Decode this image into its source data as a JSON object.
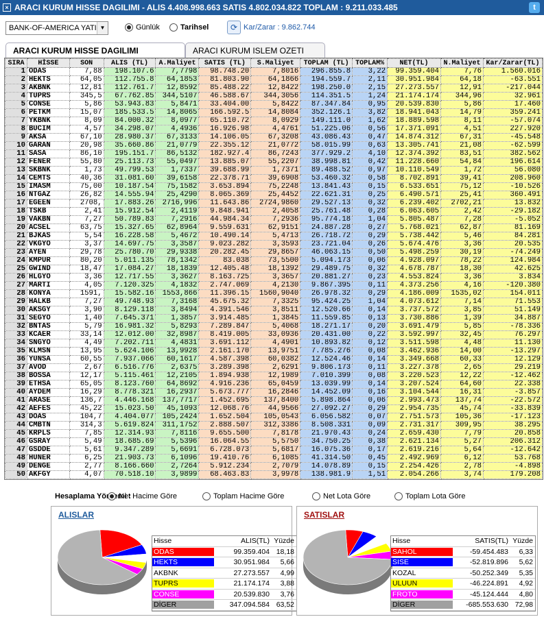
{
  "title": {
    "text": "ARACI KURUM HISSE DAGILIMI - ALIS 4.408.998.663  SATIS 4.802.034.822  TOPLAM : 9.211.033.485",
    "close": "×",
    "twitter_glyph": "t"
  },
  "toolbar": {
    "broker": "BANK-OF-AMERICA YATIRIM",
    "radio_gunluk": "Günlük",
    "radio_tarihsel": "Tarihsel",
    "karzarar": "Kar/Zarar : 9.862.744"
  },
  "tabs": [
    "ARACI KURUM HISSE DAGILIMI",
    "ARACI KURUM ISLEM OZETI"
  ],
  "table": {
    "headers": [
      "SIRA",
      "HİSSE",
      "SON",
      "ALIS (TL)",
      "A.Maliyet",
      "SATIS (TL)",
      "S.Maliyet",
      "TOPLAM (TL)",
      "TOPLAM%",
      "NET(TL)",
      "N.Maliyet",
      "Kar/Zarar(TL)"
    ],
    "rows": [
      [
        "1",
        "ODAS",
        "7,88",
        "198.107.6",
        "7,7798",
        "98.748.20",
        "7,8016",
        "296.855.8",
        "3,22",
        "99.359.404",
        "7,76",
        "1.560.016"
      ],
      [
        "2",
        "HEKTS",
        "64,05",
        "112.755.8",
        "64,1853",
        "81.803.90",
        "64,1866",
        "194.559.7",
        "2,11",
        "30.951.984",
        "64,18",
        "-63.551"
      ],
      [
        "3",
        "AKBNK",
        "12,81",
        "112.761.7",
        "12,8592",
        "85.488.22",
        "12,8422",
        "198.250.0",
        "2,15",
        "27.273.557",
        "12,91",
        "-217.044"
      ],
      [
        "4",
        "TUPRS",
        "345,5",
        "67.762.85",
        "344,5107",
        "46.588.67",
        "344,3056",
        "114.351.5",
        "1,24",
        "21.174.174",
        "344,96",
        "32.961"
      ],
      [
        "5",
        "CONSE",
        "5,86",
        "53.943.83",
        "5,8471",
        "33.404.00",
        "5,8422",
        "87.347.84",
        "0,95",
        "20.539.830",
        "5,86",
        "17.460"
      ],
      [
        "6",
        "PETKM",
        "15,07",
        "185.533.5",
        "14,8065",
        "166.592.5",
        "14,8084",
        "352.126.1",
        "3,82",
        "18.941.043",
        "14,79",
        "359.241"
      ],
      [
        "7",
        "YKBNK",
        "8,09",
        "84.000.32",
        "8,0977",
        "65.110.72",
        "8,0929",
        "149.111.0",
        "1,62",
        "18.889.598",
        "8,11",
        "-57.074"
      ],
      [
        "8",
        "BUCIM",
        "4,57",
        "34.298.07",
        "4,4936",
        "16.926.98",
        "4,4761",
        "51.225.06",
        "0,56",
        "17.371.091",
        "4,51",
        "227.920"
      ],
      [
        "9",
        "AKSA",
        "67,10",
        "28.980.37",
        "67,3133",
        "14.106.05",
        "67,3208",
        "43.086.43",
        "0,47",
        "14.874.312",
        "67,31",
        "-45.548"
      ],
      [
        "10",
        "GARAN",
        "20,98",
        "35.660.86",
        "21,0779",
        "22.355.12",
        "21,0772",
        "58.015.99",
        "0,63",
        "13.305.741",
        "21,08",
        "-62.599"
      ],
      [
        "11",
        "SASA",
        "86,10",
        "195.151.7",
        "86,5132",
        "182.927.4",
        "86,7243",
        "377.929.2",
        "4,10",
        "12.374.392",
        "83,51",
        "382.562"
      ],
      [
        "12",
        "FENER",
        "55,80",
        "25.113.73",
        "55,0497",
        "13.885.07",
        "55,2207",
        "38.998.81",
        "0,42",
        "11.228.660",
        "54,84",
        "196.614"
      ],
      [
        "13",
        "SKBNK",
        "1,73",
        "49.799.53",
        "1,7337",
        "39.688.99",
        "1,7371",
        "89.488.52",
        "0,97",
        "10.110.549",
        "1,72",
        "56.080"
      ],
      [
        "14",
        "CEMTS",
        "40,36",
        "31.081.60",
        "39,6158",
        "22.378.71",
        "39,6908",
        "53.460.32",
        "0,58",
        "8.702.891",
        "39,41",
        "208.960"
      ],
      [
        "15",
        "IMASM",
        "75,00",
        "10.187.54",
        "75,1582",
        "3.653.894",
        "75,2248",
        "13.841.43",
        "0,15",
        "6.533.651",
        "75,12",
        "-10.526"
      ],
      [
        "16",
        "NTGAZ",
        "26,82",
        "14.555.94",
        "25,4290",
        "8.065.369",
        "25,4452",
        "22.621.31",
        "0,25",
        "6.490.571",
        "25,41",
        "360.491"
      ],
      [
        "17",
        "EGEEN",
        "2708,",
        "17.883.26",
        "2716,996",
        "11.643.86",
        "2724,9860",
        "29.527.13",
        "0,32",
        "6.239.402",
        "2702,21",
        "13.832"
      ],
      [
        "18",
        "TSKB",
        "2,41",
        "15.912.54",
        "2,4119",
        "9.848.941",
        "2,4058",
        "25.761.48",
        "0,28",
        "6.063.605",
        "2,42",
        "-29.182"
      ],
      [
        "19",
        "VAKBN",
        "7,27",
        "50.789.83",
        "7,2916",
        "44.984.34",
        "7,2936",
        "95.774.18",
        "1,04",
        "5.805.487",
        "7,28",
        "-5.052"
      ],
      [
        "20",
        "ACSEL",
        "63,75",
        "15.327.65",
        "62,8964",
        "9.559.631",
        "62,9151",
        "24.887.28",
        "0,27",
        "5.768.021",
        "62,87",
        "81.169"
      ],
      [
        "21",
        "BJKAS",
        "5,54",
        "16.228.58",
        "5,4672",
        "10.490.14",
        "5,4713",
        "26.718.72",
        "0,29",
        "5.738.442",
        "5,46",
        "84.281"
      ],
      [
        "22",
        "VKGYO",
        "3,37",
        "14.697.75",
        "3,3587",
        "9.023.282",
        "3,3593",
        "23.721.04",
        "0,26",
        "5.674.476",
        "3,36",
        "20.535"
      ],
      [
        "23",
        "AYEN",
        "29,78",
        "25.780.70",
        "29,9338",
        "20.282.45",
        "29,8657",
        "46.063.15",
        "0,50",
        "5.498.259",
        "30,19",
        "-74.249"
      ],
      [
        "24",
        "KMPUR",
        "80,20",
        "5.011.135",
        "78,1342",
        "83.038",
        "73,5500",
        "5.094.173",
        "0,06",
        "4.928.097",
        "78,22",
        "124.984"
      ],
      [
        "25",
        "GWIND",
        "18,47",
        "17.084.27",
        "18,1839",
        "12.405.48",
        "18,1392",
        "29.489.75",
        "0,32",
        "4.678.787",
        "18,30",
        "42.625"
      ],
      [
        "26",
        "HLGYO",
        "3,36",
        "12.717.55",
        "3,3627",
        "8.163.725",
        "3,3657",
        "20.881.27",
        "0,23",
        "4.553.824",
        "3,36",
        "3.834"
      ],
      [
        "27",
        "MARTI",
        "4,05",
        "7.120.325",
        "4,1832",
        "2.747.069",
        "4,2130",
        "9.867.395",
        "0,11",
        "4.373.256",
        "4,16",
        "-120.380"
      ],
      [
        "28",
        "KONYA",
        "1591,",
        "15.582.16",
        "1553,866",
        "11.396.15",
        "1560,9040",
        "26.978.32",
        "0,29",
        "4.186.009",
        "1535,02",
        "154.011"
      ],
      [
        "29",
        "HALKB",
        "7,27",
        "49.748.93",
        "7,3168",
        "45.675.32",
        "7,3325",
        "95.424.25",
        "1,04",
        "4.073.612",
        "7,14",
        "71.553"
      ],
      [
        "30",
        "AKSGY",
        "3,90",
        "8.129.118",
        "3,8494",
        "4.391.546",
        "3,8511",
        "12.520.66",
        "0,14",
        "3.737.572",
        "3,85",
        "51.149"
      ],
      [
        "31",
        "SEGYO",
        "1,40",
        "7.645.371",
        "1,3857",
        "3.914.485",
        "1,3845",
        "11.559.85",
        "0,13",
        "3.730.886",
        "1,39",
        "34.887"
      ],
      [
        "32",
        "BNTAS",
        "5,79",
        "16.981.32",
        "5,8293",
        "7.289.847",
        "5,4068",
        "18.271.17",
        "0,20",
        "3.691.479",
        "5,85",
        "-78.336"
      ],
      [
        "33",
        "KCAER",
        "33,14",
        "12.012.00",
        "32,8987",
        "8.419.005",
        "33,0936",
        "20.431.00",
        "0,22",
        "3.592.997",
        "32,45",
        "76.297"
      ],
      [
        "34",
        "SNGYO",
        "4,49",
        "7.202.711",
        "4,4831",
        "3.691.112",
        "4,4901",
        "10.893.82",
        "0,12",
        "3.511.598",
        "4,48",
        "11.130"
      ],
      [
        "35",
        "KLMSN",
        "13,95",
        "5.624.106",
        "13,9928",
        "2.161.170",
        "13,9751",
        "7.785.276",
        "0,08",
        "3.462.936",
        "14,00",
        "-13.297"
      ],
      [
        "36",
        "YUNSA",
        "60,55",
        "7.937.066",
        "60,1617",
        "4.587.398",
        "60,0382",
        "12.524.46",
        "0,14",
        "3.349.668",
        "60,33",
        "12.129"
      ],
      [
        "37",
        "AVOD",
        "2,67",
        "6.516.776",
        "2,6375",
        "3.289.398",
        "2,6291",
        "9.806.173",
        "0,11",
        "3.227.378",
        "2,65",
        "29.219"
      ],
      [
        "38",
        "BOSSA",
        "12,17",
        "5.115.461",
        "12,2105",
        "1.894.938",
        "12,1989",
        "7.010.399",
        "0,08",
        "3.220.523",
        "12,22",
        "-12.462"
      ],
      [
        "39",
        "ETHSA",
        "65,05",
        "8.123.760",
        "64,8692",
        "4.916.236",
        "65,0459",
        "13.039.99",
        "0,14",
        "3.207.524",
        "64,60",
        "22.338"
      ],
      [
        "40",
        "AYDEM",
        "16,29",
        "8.778.321",
        "16,2937",
        "5.673.777",
        "16,2846",
        "14.452.09",
        "0,16",
        "3.104.544",
        "16,31",
        "-3.857"
      ],
      [
        "41",
        "ARASE",
        "136,7",
        "4.446.168",
        "137,7717",
        "1.452.695",
        "137,8400",
        "5.898.864",
        "0,06",
        "2.993.473",
        "137,74",
        "-22.572"
      ],
      [
        "42",
        "AEFES",
        "45,22",
        "15.023.50",
        "45,1093",
        "12.068.76",
        "44,9566",
        "27.092.27",
        "0,29",
        "2.954.735",
        "45,74",
        "-33.839"
      ],
      [
        "43",
        "DOAS",
        "104,7",
        "4.404.077",
        "105,2424",
        "1.652.504",
        "105,0543",
        "6.056.582",
        "0,07",
        "2.751.573",
        "105,36",
        "-17.123"
      ],
      [
        "44",
        "CMBTN",
        "314,3",
        "5.619.824",
        "311,1752",
        "2.888.507",
        "312,3386",
        "8.508.331",
        "0,09",
        "2.731.317",
        "309,95",
        "38.295"
      ],
      [
        "45",
        "KRPLS",
        "7,85",
        "12.314.93",
        "7,8116",
        "9.655.500",
        "7,8178",
        "21.970.43",
        "0,24",
        "2.659.430",
        "7,79",
        "20.858"
      ],
      [
        "46",
        "GSRAY",
        "5,49",
        "18.685.69",
        "5,5396",
        "16.064.55",
        "5,5750",
        "34.750.25",
        "0,38",
        "2.621.134",
        "5,27",
        "206.312"
      ],
      [
        "47",
        "GSDDE",
        "5,61",
        "9.347.289",
        "5,6691",
        "6.728.073",
        "5,6817",
        "16.075.36",
        "0,17",
        "2.619.216",
        "5,64",
        "-12.642"
      ],
      [
        "48",
        "HUNER",
        "6,25",
        "21.903.73",
        "6,1096",
        "19.410.76",
        "6,1085",
        "41.314.50",
        "0,45",
        "2.492.969",
        "6,12",
        "53.768"
      ],
      [
        "49",
        "DENGE",
        "2,77",
        "8.166.660",
        "2,7264",
        "5.912.234",
        "2,7079",
        "14.078.89",
        "0,15",
        "2.254.426",
        "2,78",
        "-4.898"
      ],
      [
        "50",
        "AKFGY",
        "4,07",
        "70.518.10",
        "3,9899",
        "68.463.83",
        "3,9978",
        "138.981.9",
        "1,51",
        "2.054.266",
        "3,74",
        "179.208"
      ]
    ]
  },
  "calc": {
    "label": "Hesaplama Yöntemi :",
    "options": [
      "Net Hacime Göre",
      "Toplam Hacime Göre",
      "Net Lota Göre",
      "Toplam Lota Göre"
    ],
    "selected": 0
  },
  "alislar": {
    "title": "ALISLAR",
    "header": [
      "Hisse",
      "ALIS(TL)",
      "Yüzde"
    ],
    "rows": [
      {
        "name": "ODAS",
        "value": "99.359.404",
        "pct": "18,18",
        "pct_num": 18.18,
        "color": "#ff0000",
        "text": "#ffffff"
      },
      {
        "name": "HEKTS",
        "value": "30.951.984",
        "pct": "5,66",
        "pct_num": 5.66,
        "color": "#0000ff",
        "text": "#ffffff"
      },
      {
        "name": "AKBNK",
        "value": "27.273.557",
        "pct": "4,99",
        "pct_num": 4.99,
        "color": "#ffffff",
        "text": "#000000"
      },
      {
        "name": "TUPRS",
        "value": "21.174.174",
        "pct": "3,88",
        "pct_num": 3.88,
        "color": "#ffff00",
        "text": "#000000"
      },
      {
        "name": "CONSE",
        "value": "20.539.830",
        "pct": "3,76",
        "pct_num": 3.76,
        "color": "#ff00ff",
        "text": "#ffffff"
      },
      {
        "name": "DİGER",
        "value": "347.094.584",
        "pct": "63,52",
        "pct_num": 63.52,
        "color": "#a0a0a0",
        "text": "#000000"
      }
    ]
  },
  "satislar": {
    "title": "SATISLAR",
    "header": [
      "Hisse",
      "SATIS(TL)",
      "Yüzde"
    ],
    "rows": [
      {
        "name": "SAHOL",
        "value": "-59.454.483",
        "pct": "6,33",
        "pct_num": 6.33,
        "color": "#ff0000",
        "text": "#ffffff"
      },
      {
        "name": "SISE",
        "value": "-52.819.896",
        "pct": "5,62",
        "pct_num": 5.62,
        "color": "#0000ff",
        "text": "#ffffff"
      },
      {
        "name": "KOZAL",
        "value": "-50.252.349",
        "pct": "5,35",
        "pct_num": 5.35,
        "color": "#ffffff",
        "text": "#000000"
      },
      {
        "name": "ULUUN",
        "value": "-46.224.891",
        "pct": "4,92",
        "pct_num": 4.92,
        "color": "#ffff00",
        "text": "#000000"
      },
      {
        "name": "FROTO",
        "value": "-45.124.444",
        "pct": "4,80",
        "pct_num": 4.8,
        "color": "#ff00ff",
        "text": "#ffffff"
      },
      {
        "name": "DİGER",
        "value": "-685.553.630",
        "pct": "72,98",
        "pct_num": 72.98,
        "color": "#a0a0a0",
        "text": "#000000"
      }
    ]
  }
}
